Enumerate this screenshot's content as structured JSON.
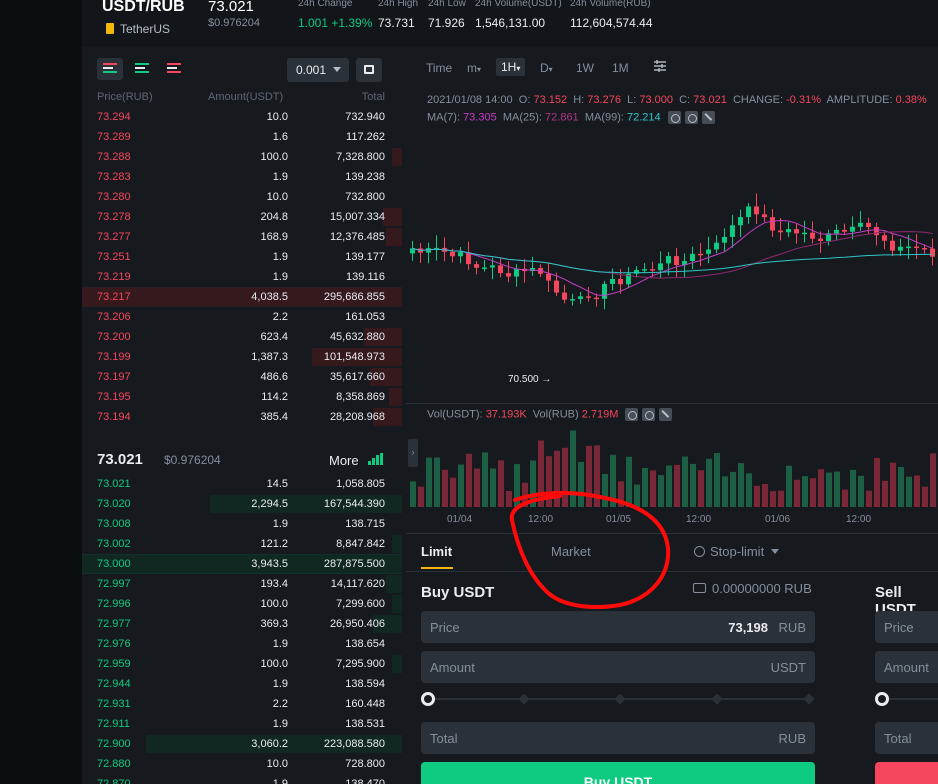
{
  "header": {
    "pair": "USDT/RUB",
    "coin_name": "TetherUS",
    "last_price": "73.021",
    "last_price_usd": "$0.976204",
    "stats": [
      {
        "label": "24h Change",
        "value": "1.001 +1.39%"
      },
      {
        "label": "24h High",
        "value": "73.731"
      },
      {
        "label": "24h Low",
        "value": "71.926"
      },
      {
        "label": "24h Volume(USDT)",
        "value": "1,546,131.00"
      },
      {
        "label": "24h Volume(RUB)",
        "value": "112,604,574.44"
      }
    ]
  },
  "orderbook": {
    "precision": "0.001",
    "columns": {
      "price": "Price(RUB)",
      "amount": "Amount(USDT)",
      "total": "Total"
    },
    "asks": [
      {
        "price": "73.294",
        "amount": "10.0",
        "total": "732.940",
        "depth": 0.0
      },
      {
        "price": "73.289",
        "amount": "1.6",
        "total": "117.262",
        "depth": 0.0
      },
      {
        "price": "73.288",
        "amount": "100.0",
        "total": "7,328.800",
        "depth": 0.03
      },
      {
        "price": "73.283",
        "amount": "1.9",
        "total": "139.238",
        "depth": 0.0
      },
      {
        "price": "73.280",
        "amount": "10.0",
        "total": "732.800",
        "depth": 0.0
      },
      {
        "price": "73.278",
        "amount": "204.8",
        "total": "15,007.334",
        "depth": 0.06
      },
      {
        "price": "73.277",
        "amount": "168.9",
        "total": "12,376.485",
        "depth": 0.05
      },
      {
        "price": "73.251",
        "amount": "1.9",
        "total": "139.177",
        "depth": 0.0
      },
      {
        "price": "73.219",
        "amount": "1.9",
        "total": "139.116",
        "depth": 0.0
      },
      {
        "price": "73.217",
        "amount": "4,038.5",
        "total": "295,686.855",
        "depth": 1.0
      },
      {
        "price": "73.206",
        "amount": "2.2",
        "total": "161.053",
        "depth": 0.0
      },
      {
        "price": "73.200",
        "amount": "623.4",
        "total": "45,632.880",
        "depth": 0.12
      },
      {
        "price": "73.199",
        "amount": "1,387.3",
        "total": "101,548.973",
        "depth": 0.28
      },
      {
        "price": "73.197",
        "amount": "486.6",
        "total": "35,617.660",
        "depth": 0.1
      },
      {
        "price": "73.195",
        "amount": "114.2",
        "total": "8,358.869",
        "depth": 0.04
      },
      {
        "price": "73.194",
        "amount": "385.4",
        "total": "28,208.968",
        "depth": 0.09
      }
    ],
    "mid": {
      "price": "73.021",
      "usd": "$0.976204",
      "more": "More"
    },
    "bids": [
      {
        "price": "73.021",
        "amount": "14.5",
        "total": "1,058.805",
        "depth": 0.0
      },
      {
        "price": "73.020",
        "amount": "2,294.5",
        "total": "167,544.390",
        "depth": 0.6
      },
      {
        "price": "73.008",
        "amount": "1.9",
        "total": "138.715",
        "depth": 0.0
      },
      {
        "price": "73.002",
        "amount": "121.2",
        "total": "8,847.842",
        "depth": 0.03
      },
      {
        "price": "73.000",
        "amount": "3,943.5",
        "total": "287,875.500",
        "depth": 1.0
      },
      {
        "price": "72.997",
        "amount": "193.4",
        "total": "14,117.620",
        "depth": 0.05
      },
      {
        "price": "72.996",
        "amount": "100.0",
        "total": "7,299.600",
        "depth": 0.03
      },
      {
        "price": "72.977",
        "amount": "369.3",
        "total": "26,950.406",
        "depth": 0.09
      },
      {
        "price": "72.976",
        "amount": "1.9",
        "total": "138.654",
        "depth": 0.0
      },
      {
        "price": "72.959",
        "amount": "100.0",
        "total": "7,295.900",
        "depth": 0.03
      },
      {
        "price": "72.944",
        "amount": "1.9",
        "total": "138.594",
        "depth": 0.0
      },
      {
        "price": "72.931",
        "amount": "2.2",
        "total": "160.448",
        "depth": 0.0
      },
      {
        "price": "72.911",
        "amount": "1.9",
        "total": "138.531",
        "depth": 0.0
      },
      {
        "price": "72.900",
        "amount": "3,060.2",
        "total": "223,088.580",
        "depth": 0.8
      },
      {
        "price": "72.880",
        "amount": "10.0",
        "total": "728.800",
        "depth": 0.0
      },
      {
        "price": "72.870",
        "amount": "1.9",
        "total": "138.470",
        "depth": 0.0
      }
    ]
  },
  "chart": {
    "toolbar": {
      "time": "Time",
      "minutes": "m",
      "hour": "1H",
      "day": "D",
      "week": "1W",
      "month": "1M"
    },
    "candle_info": {
      "date": "2021/01/08 14:00",
      "open_label": "O:",
      "open": "73.152",
      "high_label": "H:",
      "high": "73.276",
      "low_label": "L:",
      "low": "73.000",
      "close_label": "C:",
      "close": "73.021",
      "change_label": "CHANGE:",
      "change": "-0.31%",
      "amplitude_label": "AMPLITUDE:",
      "amplitude": "0.38%"
    },
    "ma": {
      "ma7_label": "MA(7):",
      "ma7": "73.305",
      "ma25_label": "MA(25):",
      "ma25": "72.861",
      "ma99_label": "MA(99):",
      "ma99": "72.214"
    },
    "volume": {
      "usdt_label": "Vol(USDT):",
      "usdt": "37.193K",
      "rub_label": "Vol(RUB)",
      "rub": "2.719M"
    },
    "low_marker": "70.500",
    "x_labels": [
      "01/04",
      "12:00",
      "01/05",
      "12:00",
      "01/06",
      "12:00"
    ],
    "colors": {
      "up": "#0ecb81",
      "down": "#f6465d",
      "ma7": "#c73cc7",
      "ma25": "#8e2a6f",
      "ma99": "#2ec7c9"
    }
  },
  "trade": {
    "tabs": [
      "Limit",
      "Market",
      "Stop-limit"
    ],
    "buy": {
      "title": "Buy USDT",
      "balance": "0.00000000 RUB",
      "price_label": "Price",
      "price_value": "73,198",
      "price_unit": "RUB",
      "amount_label": "Amount",
      "amount_unit": "USDT",
      "total_label": "Total",
      "total_unit": "RUB",
      "button": "Buy USDT"
    },
    "sell": {
      "title": "Sell USDT",
      "price_label": "Price",
      "amount_label": "Amount",
      "total_label": "Total"
    }
  }
}
